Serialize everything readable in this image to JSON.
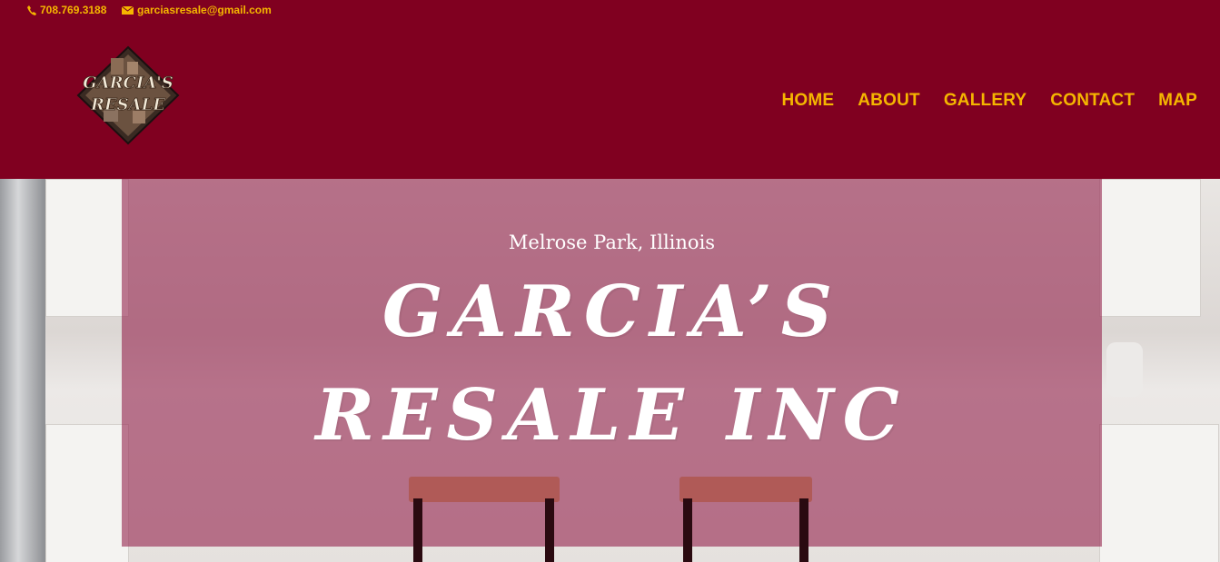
{
  "topbar": {
    "phone": "708.769.3188",
    "email": "garciasresale@gmail.com"
  },
  "logo": {
    "line1": "GARCIA'S",
    "line2": "RESALE"
  },
  "nav": {
    "items": [
      "HOME",
      "ABOUT",
      "GALLERY",
      "CONTACT",
      "MAP"
    ]
  },
  "hero": {
    "location": "Melrose Park, Illinois",
    "title_line1": "GARCIA’S",
    "title_line2": "RESALE INC"
  },
  "colors": {
    "brand": "#800020",
    "accent": "#f5b600",
    "overlay": "#962850"
  },
  "icons": {
    "phone": "phone-icon",
    "email": "envelope-icon"
  }
}
